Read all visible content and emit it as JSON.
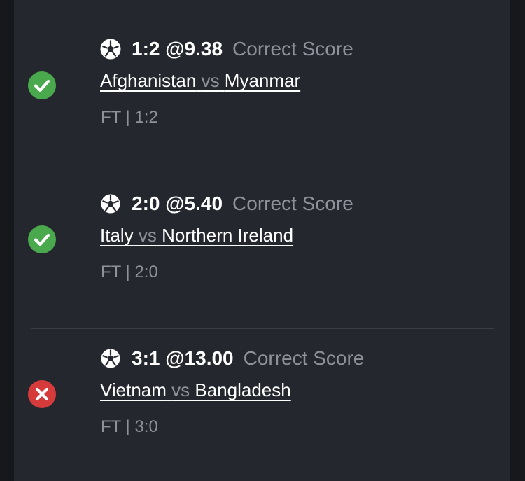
{
  "theme": {
    "background": "#17181b",
    "card": "#25272e",
    "win_color": "#4aa84d",
    "loss_color": "#d63b3b",
    "muted_text": "#8e919a"
  },
  "bets": [
    {
      "status": "win",
      "status_icon": "check-circle-icon",
      "pick": "1:2 @9.38",
      "market": "Correct Score",
      "home": "Afghanistan",
      "vs": "vs",
      "away": "Myanmar",
      "result": "FT | 1:2"
    },
    {
      "status": "win",
      "status_icon": "check-circle-icon",
      "pick": "2:0 @5.40",
      "market": "Correct Score",
      "home": "Italy",
      "vs": "vs",
      "away": "Northern Ireland",
      "result": "FT | 2:0"
    },
    {
      "status": "loss",
      "status_icon": "x-circle-icon",
      "pick": "3:1 @13.00",
      "market": "Correct Score",
      "home": "Vietnam",
      "vs": "vs",
      "away": "Bangladesh",
      "result": "FT | 3:0"
    }
  ]
}
